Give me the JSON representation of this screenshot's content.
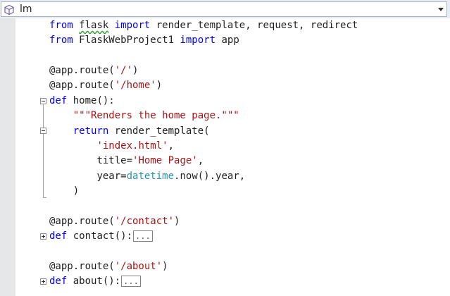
{
  "navigation": {
    "selected": "lm",
    "icon": "cube-icon"
  },
  "colors": {
    "keyword": "#0000ff",
    "string": "#a31515",
    "class": "#2b91af",
    "text": "#1e1e1e"
  },
  "code": {
    "l1": {
      "kw1": "from",
      "mod": "flask",
      "kw2": "import",
      "rest": " render_template, request, redirect"
    },
    "l2": {
      "kw1": "from",
      "mod": "FlaskWebProject1",
      "kw2": "import",
      "rest": " app"
    },
    "l4": {
      "dec": "@app.route(",
      "str": "'/'",
      "close": ")"
    },
    "l5": {
      "dec": "@app.route(",
      "str": "'/home'",
      "close": ")"
    },
    "l6": {
      "kw": "def",
      "rest": " home():"
    },
    "l7": {
      "indent": "    ",
      "str": "\"\"\"Renders the home page.\"\"\""
    },
    "l8": {
      "indent": "    ",
      "kw": "return",
      "rest": " render_template("
    },
    "l9": {
      "indent": "        ",
      "str": "'index.html'",
      "rest": ","
    },
    "l10": {
      "indent": "        ",
      "pre": "title=",
      "str": "'Home Page'",
      "rest": ","
    },
    "l11": {
      "indent": "        ",
      "pre": "year=",
      "cls": "datetime",
      "rest": ".now().year,"
    },
    "l12": {
      "text": "    )"
    },
    "l14": {
      "dec": "@app.route(",
      "str": "'/contact'",
      "close": ")"
    },
    "l15": {
      "kw": "def",
      "rest": " contact():",
      "collapsed": "..."
    },
    "l17": {
      "dec": "@app.route(",
      "str": "'/about'",
      "close": ")"
    },
    "l18": {
      "kw": "def",
      "rest": " about():",
      "collapsed": "..."
    }
  }
}
